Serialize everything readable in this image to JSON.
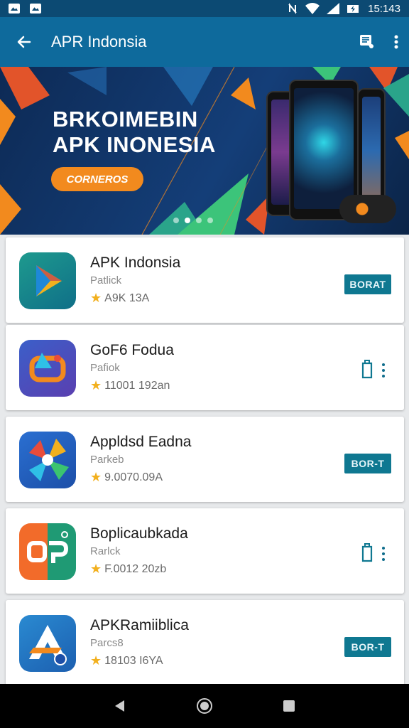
{
  "status_bar": {
    "time": "15:143"
  },
  "app_bar": {
    "title": "APR Indonsia"
  },
  "banner": {
    "headline_line1": "BRKOIMEBIN",
    "headline_line2": "APK INONESIA",
    "cta_label": "CORNEROS",
    "active_slide": 2,
    "slide_count": 4
  },
  "apps": [
    {
      "name": "APK Indonsia",
      "developer": "Patlick",
      "rating": "A9K 13A",
      "action": "install",
      "action_label": "BORAT",
      "icon": "play-triangle-icon"
    },
    {
      "name": "GoF6 Fodua",
      "developer": "Pafiok",
      "rating": "11001 192an",
      "action": "download",
      "action_label": "",
      "icon": "shapes-icon"
    },
    {
      "name": "Appldsd Eadna",
      "developer": "Parkeb",
      "rating": "9.0070.09A",
      "action": "install",
      "action_label": "BOR-T",
      "icon": "pinwheel-icon"
    },
    {
      "name": "Boplicaubkada",
      "developer": "Rarlck",
      "rating": "F.0012 20zb",
      "action": "download",
      "action_label": "",
      "icon": "op-logo-icon"
    },
    {
      "name": "APKRamiiblica",
      "developer": "Parcs8",
      "rating": "18103 I6YA",
      "action": "install",
      "action_label": "BOR-T",
      "icon": "arrow-a-icon"
    }
  ],
  "colors": {
    "app_bar": "#0e6a9c",
    "status_bar": "#0c4a73",
    "accent_orange": "#f28a1e",
    "install_button": "#0f7891",
    "star": "#f2b01e"
  }
}
